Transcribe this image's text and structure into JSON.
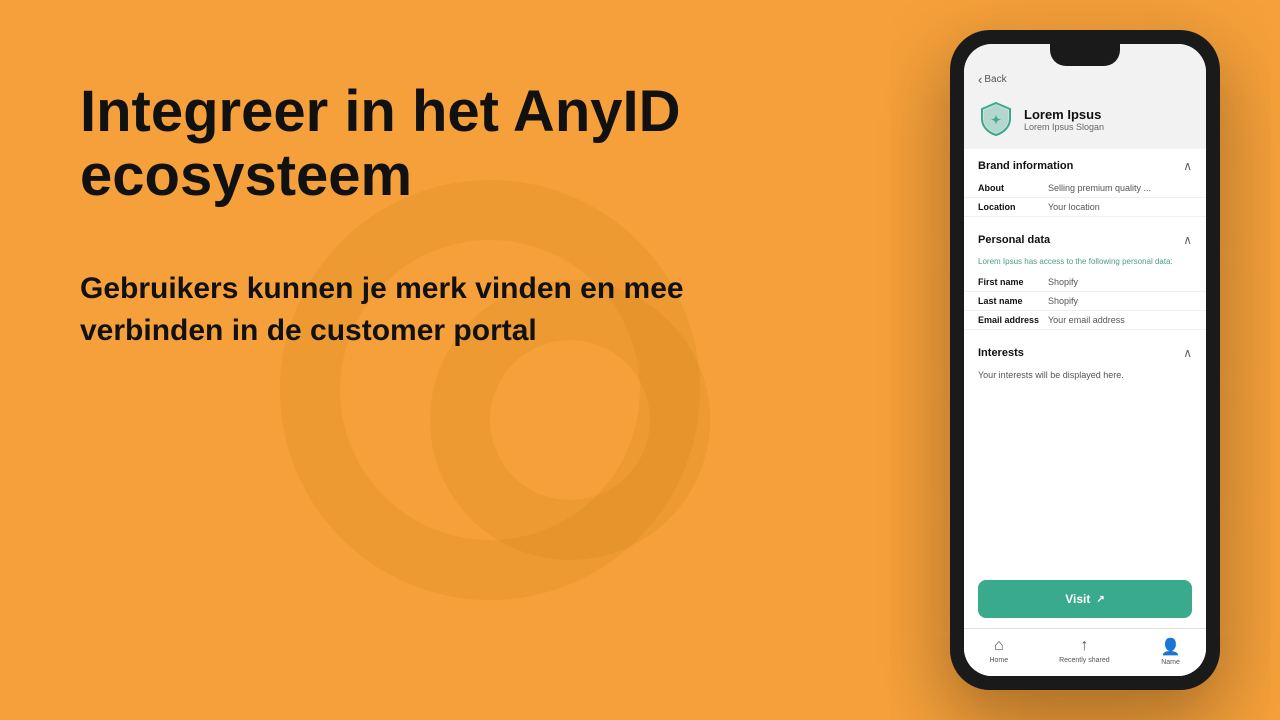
{
  "background": {
    "color": "#F5A03A"
  },
  "left": {
    "main_heading": "Integreer in het AnyID ecosysteem",
    "sub_heading": "Gebruikers kunnen je merk vinden en mee verbinden in de customer portal"
  },
  "phone": {
    "back_label": "Back",
    "brand": {
      "name": "Lorem Ipsus",
      "slogan": "Lorem Ipsus Slogan"
    },
    "brand_information": {
      "title": "Brand information",
      "about_label": "About",
      "about_value": "Selling premium quality ...",
      "location_label": "Location",
      "location_value": "Your location"
    },
    "personal_data": {
      "title": "Personal data",
      "note": "Lorem Ipsus has access to the following personal data:",
      "first_name_label": "First name",
      "first_name_value": "Shopify",
      "last_name_label": "Last name",
      "last_name_value": "Shopify",
      "email_label": "Email address",
      "email_value": "Your email address"
    },
    "interests": {
      "title": "Interests",
      "note": "Your interests will be displayed here."
    },
    "visit_button": "Visit",
    "nav": {
      "home_label": "Home",
      "recently_shared_label": "Recently shared",
      "name_label": "Name"
    }
  }
}
